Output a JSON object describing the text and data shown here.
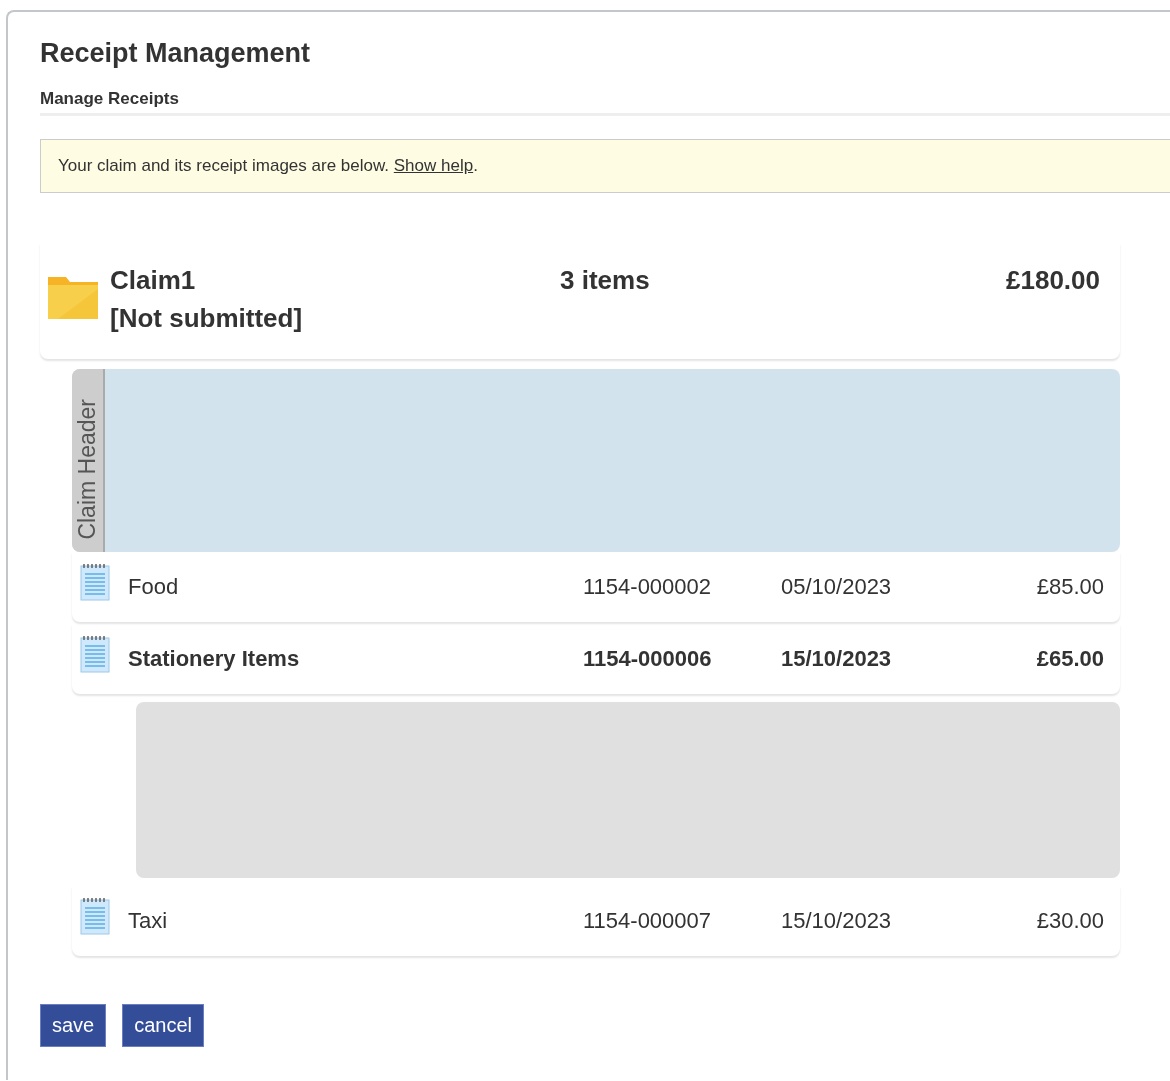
{
  "page": {
    "title": "Receipt Management",
    "subtitle": "Manage Receipts"
  },
  "notice": {
    "text": "Your claim and its receipt images are below.",
    "link": "Show help",
    "after": "."
  },
  "claim": {
    "name": "Claim1",
    "status": "[Not submitted]",
    "count": "3 items",
    "total": "£180.00"
  },
  "header_panel": {
    "label": "Claim Header"
  },
  "receipts": [
    {
      "name": "Food",
      "ref": "1154-000002",
      "date": "05/10/2023",
      "amount": "£85.00",
      "selected": false,
      "expanded": false
    },
    {
      "name": "Stationery Items",
      "ref": "1154-000006",
      "date": "15/10/2023",
      "amount": "£65.00",
      "selected": true,
      "expanded": true
    },
    {
      "name": "Taxi",
      "ref": "1154-000007",
      "date": "15/10/2023",
      "amount": "£30.00",
      "selected": false,
      "expanded": false
    }
  ],
  "buttons": [
    "save",
    "cancel"
  ]
}
